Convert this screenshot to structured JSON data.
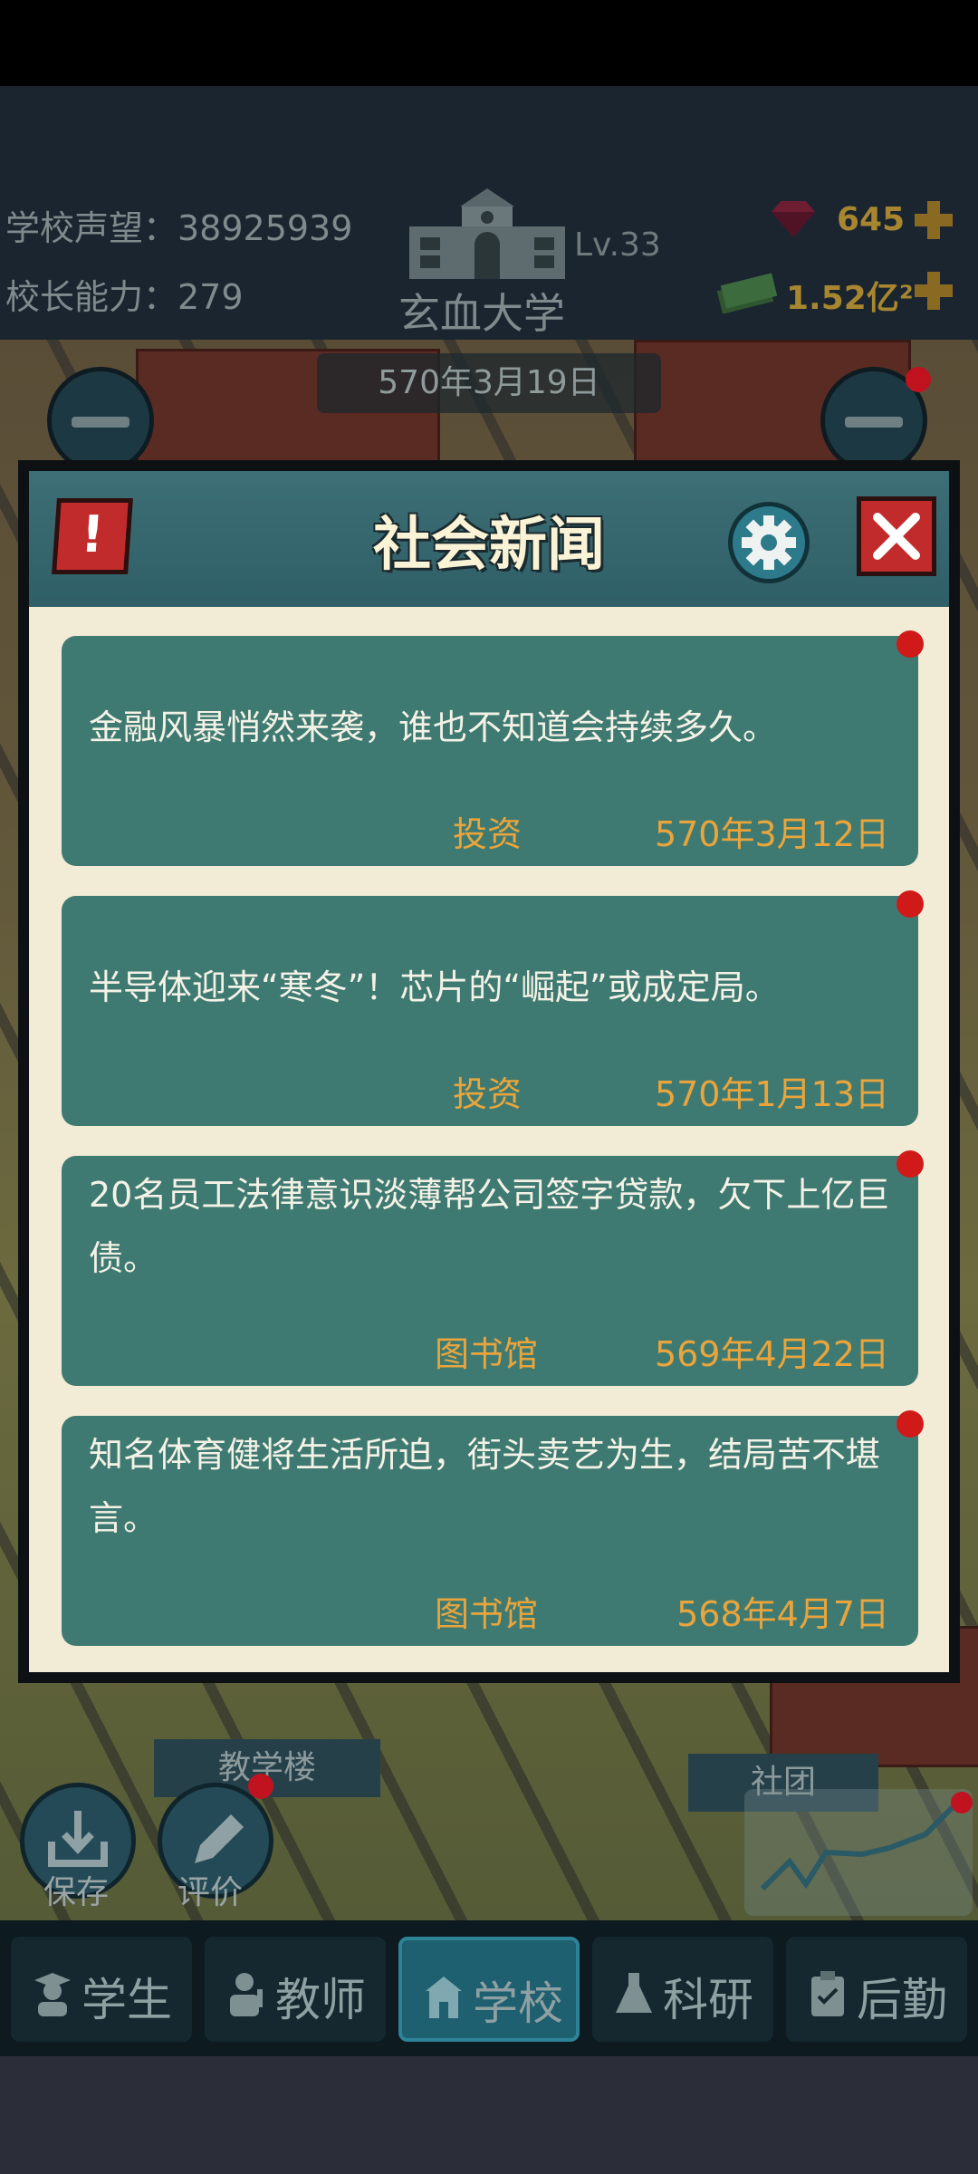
{
  "header": {
    "reputation_label": "学校声望：38925939",
    "ability_label": "校长能力：279",
    "school_level": "Lv.33",
    "school_name": "玄血大学",
    "gems": "645",
    "money": "1.52亿²",
    "date": "570年3月19日"
  },
  "map": {
    "teaching_building": "教学楼",
    "club": "社团",
    "save_label": "保存",
    "review_label": "评价"
  },
  "modal": {
    "title": "社会新闻",
    "alert_glyph": "!",
    "news": [
      {
        "text": "金融风暴悄然来袭，谁也不知道会持续多久。",
        "tag": "投资",
        "date": "570年3月12日"
      },
      {
        "text": "半导体迎来“寒冬”！芯片的“崛起”或成定局。",
        "tag": "投资",
        "date": "570年1月13日"
      },
      {
        "text": "20名员工法律意识淡薄帮公司签字贷款，欠下上亿巨债。",
        "tag": "图书馆",
        "date": "569年4月22日"
      },
      {
        "text": "知名体育健将生活所迫，街头卖艺为生，结局苦不堪言。",
        "tag": "图书馆",
        "date": "568年4月7日"
      }
    ]
  },
  "nav": {
    "tabs": [
      {
        "label": "学生",
        "icon": "student-icon"
      },
      {
        "label": "教师",
        "icon": "teacher-icon"
      },
      {
        "label": "学校",
        "icon": "school-icon",
        "active": true
      },
      {
        "label": "科研",
        "icon": "flask-icon"
      },
      {
        "label": "后勤",
        "icon": "clipboard-icon"
      }
    ]
  },
  "colors": {
    "card_bg": "#3f7a72",
    "accent_orange": "#e9a53c",
    "modal_bg": "#f2ecd6",
    "header_teal": "#3d6f77"
  }
}
